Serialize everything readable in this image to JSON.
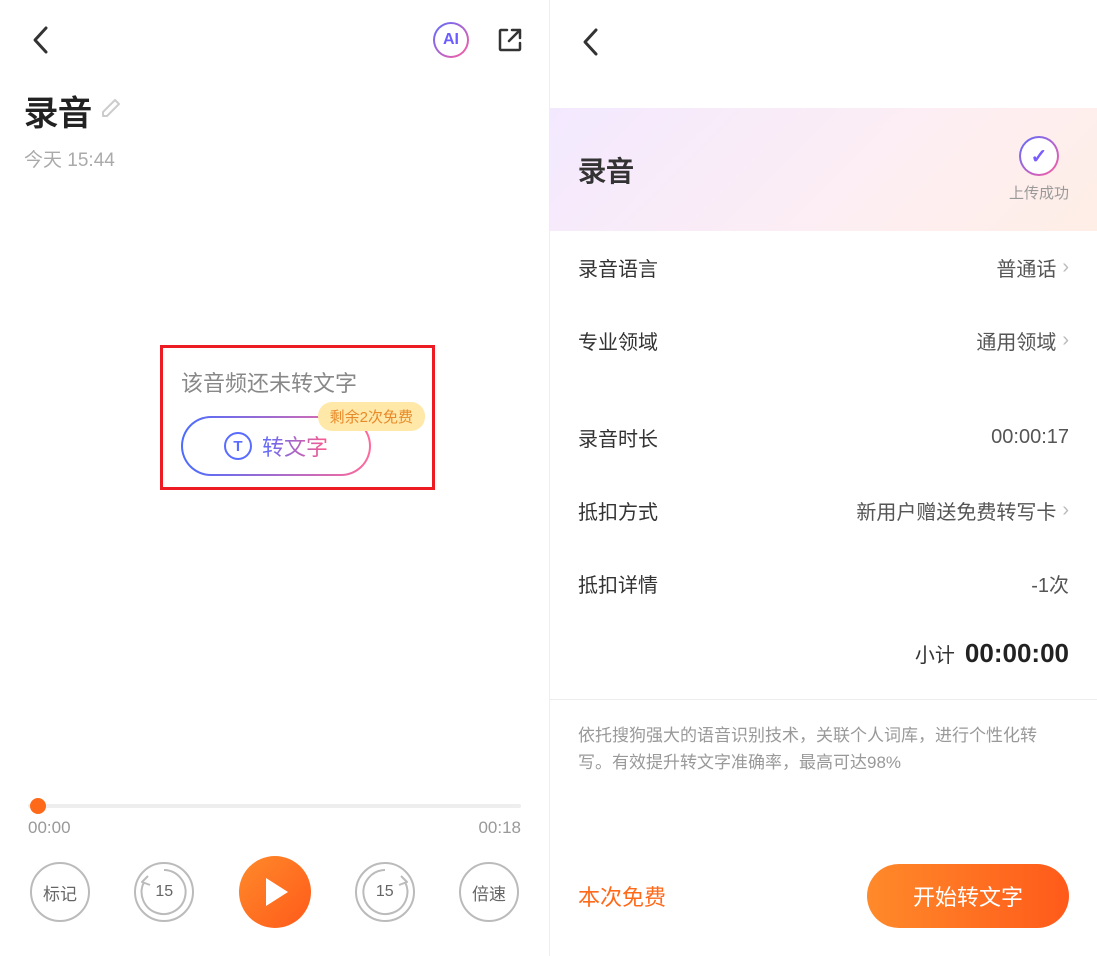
{
  "left": {
    "header": {
      "ai_label": "AI"
    },
    "title": "录音",
    "timestamp": "今天 15:44",
    "highlight": {
      "message": "该音频还未转文字",
      "convert_label": "转文字",
      "badge": "剩余2次免费"
    },
    "player": {
      "current_time": "00:00",
      "total_time": "00:18",
      "mark_label": "标记",
      "skip_back": "15",
      "skip_fwd": "15",
      "speed_label": "倍速"
    }
  },
  "right": {
    "title": "录音",
    "upload_status_label": "上传成功",
    "rows": {
      "language": {
        "label": "录音语言",
        "value": "普通话"
      },
      "domain": {
        "label": "专业领域",
        "value": "通用领域"
      },
      "duration": {
        "label": "录音时长",
        "value": "00:00:17"
      },
      "discount": {
        "label": "抵扣方式",
        "value": "新用户赠送免费转写卡"
      },
      "detail": {
        "label": "抵扣详情",
        "value": "-1次"
      }
    },
    "subtotal": {
      "label": "小计",
      "value": "00:00:00"
    },
    "description": "依托搜狗强大的语音识别技术，关联个人词库，进行个性化转写。有效提升转文字准确率，最高可达98%",
    "bottom": {
      "free_label": "本次免费",
      "start_label": "开始转文字"
    }
  }
}
